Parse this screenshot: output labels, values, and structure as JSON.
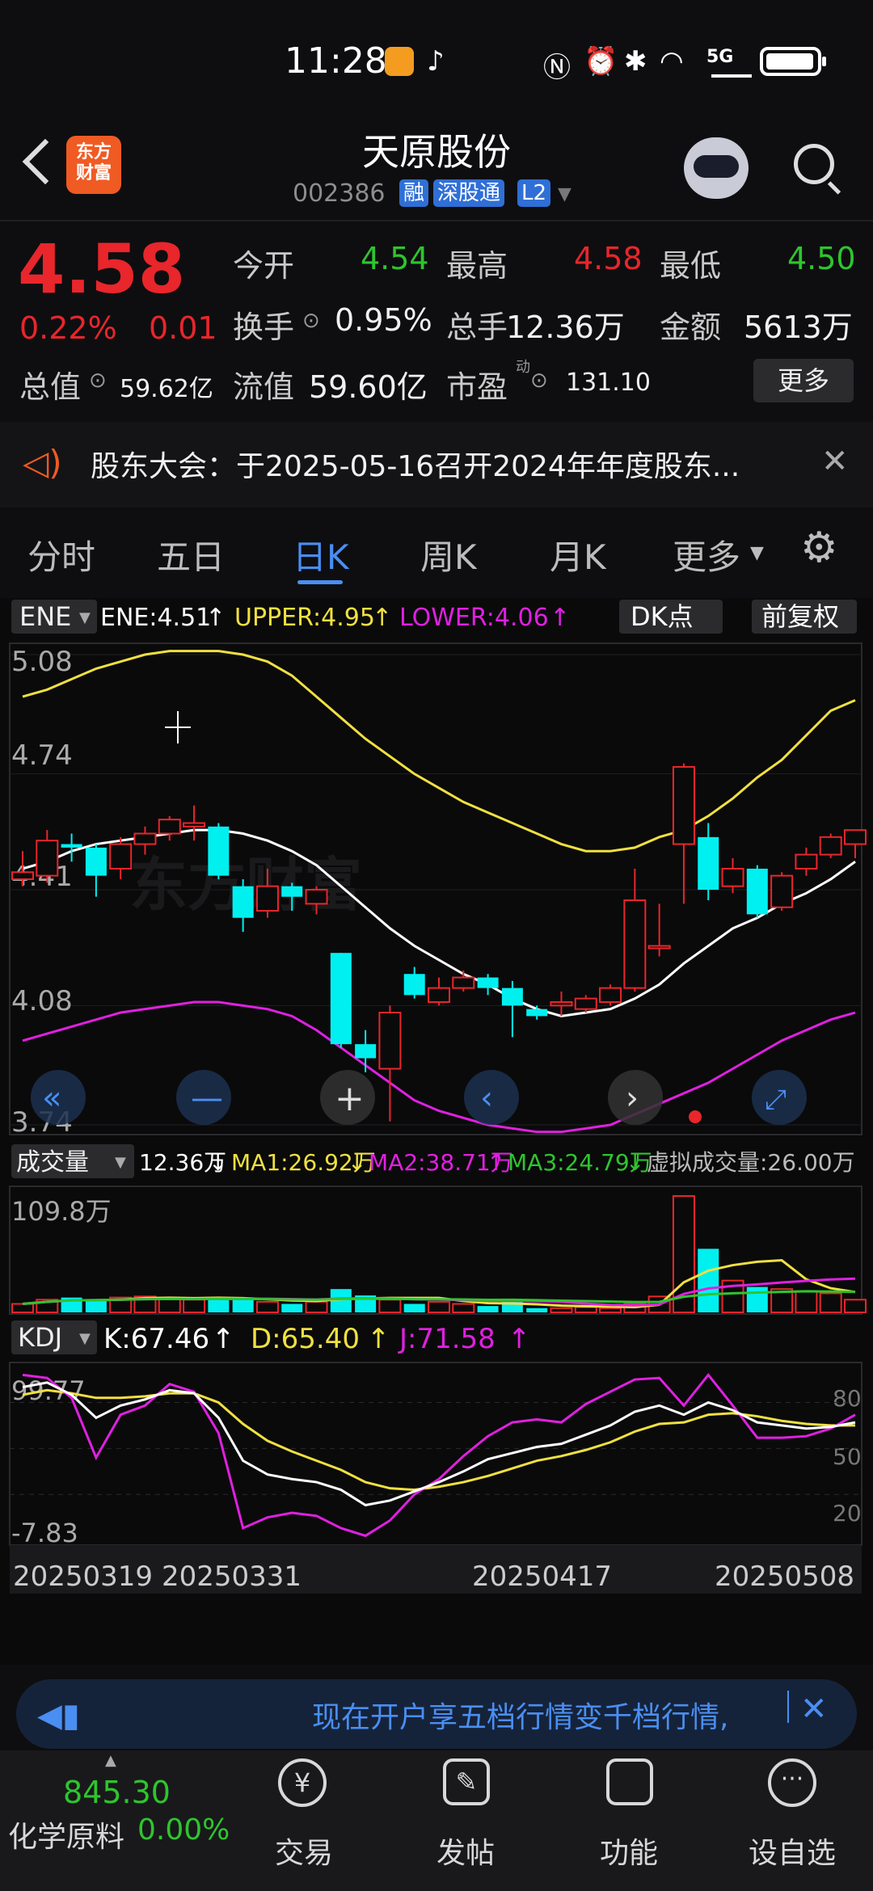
{
  "status_bar": {
    "time": "11:28",
    "network": "5G"
  },
  "header": {
    "logo_text": "东方\n财富",
    "title": "天原股份",
    "code": "002386",
    "tags": [
      "融",
      "深股通",
      "L2"
    ]
  },
  "quote": {
    "price": "4.58",
    "change_pct": "0.22%",
    "change": "0.01",
    "fields": [
      {
        "label": "今开",
        "value": "4.54"
      },
      {
        "label": "最高",
        "value": "4.58"
      },
      {
        "label": "最低",
        "value": "4.50"
      },
      {
        "label": "换手",
        "value": "0.95%"
      },
      {
        "label": "总手",
        "value": "12.36万"
      },
      {
        "label": "金额",
        "value": "5613万"
      },
      {
        "label": "总值",
        "value": "59.62亿"
      },
      {
        "label": "流值",
        "value": "59.60亿"
      },
      {
        "label": "市盈",
        "value": "131.10",
        "sup": "动"
      }
    ],
    "more_label": "更多"
  },
  "notice": {
    "text": "股东大会：于2025-05-16召开2024年年度股东..."
  },
  "tabs": [
    {
      "label": "分时",
      "active": false
    },
    {
      "label": "五日",
      "active": false
    },
    {
      "label": "日K",
      "active": true
    },
    {
      "label": "周K",
      "active": false
    },
    {
      "label": "月K",
      "active": false
    },
    {
      "label": "更多",
      "active": false
    }
  ],
  "colors": {
    "up": "#e8262b",
    "down": "#00f0f0",
    "ma_white": "#ffffff",
    "upper": "#f0e040",
    "lower": "#e020e0",
    "accent": "#4a8ef2"
  },
  "chart_data": [
    {
      "type": "candlestick",
      "indicator": {
        "name": "ENE",
        "ene": "ENE:4.51",
        "upper": "UPPER:4.95",
        "lower": "LOWER:4.06"
      },
      "buttons": [
        "DK点",
        "前复权"
      ],
      "y_ticks": [
        "5.08",
        "4.74",
        "4.41",
        "4.08",
        "3.74"
      ],
      "ylim": [
        3.74,
        5.08
      ],
      "candles": [
        {
          "o": 4.44,
          "c": 4.46,
          "h": 4.52,
          "l": 4.42
        },
        {
          "o": 4.45,
          "c": 4.55,
          "h": 4.58,
          "l": 4.43
        },
        {
          "o": 4.54,
          "c": 4.53,
          "h": 4.57,
          "l": 4.49
        },
        {
          "o": 4.53,
          "c": 4.45,
          "h": 4.54,
          "l": 4.39
        },
        {
          "o": 4.47,
          "c": 4.54,
          "h": 4.56,
          "l": 4.44
        },
        {
          "o": 4.54,
          "c": 4.57,
          "h": 4.59,
          "l": 4.51
        },
        {
          "o": 4.57,
          "c": 4.61,
          "h": 4.62,
          "l": 4.55
        },
        {
          "o": 4.59,
          "c": 4.6,
          "h": 4.65,
          "l": 4.55
        },
        {
          "o": 4.59,
          "c": 4.45,
          "h": 4.6,
          "l": 4.44
        },
        {
          "o": 4.42,
          "c": 4.33,
          "h": 4.44,
          "l": 4.29
        },
        {
          "o": 4.35,
          "c": 4.42,
          "h": 4.47,
          "l": 4.33
        },
        {
          "o": 4.42,
          "c": 4.39,
          "h": 4.43,
          "l": 4.35
        },
        {
          "o": 4.37,
          "c": 4.41,
          "h": 4.42,
          "l": 4.34
        },
        {
          "o": 4.23,
          "c": 3.97,
          "h": 4.23,
          "l": 3.96
        },
        {
          "o": 3.97,
          "c": 3.93,
          "h": 4.01,
          "l": 3.89
        },
        {
          "o": 3.9,
          "c": 4.06,
          "h": 4.08,
          "l": 3.75
        },
        {
          "o": 4.17,
          "c": 4.11,
          "h": 4.19,
          "l": 4.1
        },
        {
          "o": 4.09,
          "c": 4.13,
          "h": 4.16,
          "l": 4.08
        },
        {
          "o": 4.13,
          "c": 4.16,
          "h": 4.18,
          "l": 4.12
        },
        {
          "o": 4.16,
          "c": 4.13,
          "h": 4.17,
          "l": 4.11
        },
        {
          "o": 4.13,
          "c": 4.08,
          "h": 4.15,
          "l": 3.99
        },
        {
          "o": 4.07,
          "c": 4.05,
          "h": 4.08,
          "l": 4.04
        },
        {
          "o": 4.08,
          "c": 4.09,
          "h": 4.12,
          "l": 4.05
        },
        {
          "o": 4.07,
          "c": 4.1,
          "h": 4.11,
          "l": 4.06
        },
        {
          "o": 4.09,
          "c": 4.13,
          "h": 4.14,
          "l": 4.08
        },
        {
          "o": 4.13,
          "c": 4.38,
          "h": 4.47,
          "l": 4.12
        },
        {
          "o": 4.25,
          "c": 4.25,
          "h": 4.37,
          "l": 4.22
        },
        {
          "o": 4.54,
          "c": 4.76,
          "h": 4.77,
          "l": 4.37
        },
        {
          "o": 4.56,
          "c": 4.41,
          "h": 4.6,
          "l": 4.38
        },
        {
          "o": 4.42,
          "c": 4.47,
          "h": 4.5,
          "l": 4.4
        },
        {
          "o": 4.47,
          "c": 4.34,
          "h": 4.48,
          "l": 4.33
        },
        {
          "o": 4.36,
          "c": 4.45,
          "h": 4.46,
          "l": 4.35
        },
        {
          "o": 4.47,
          "c": 4.51,
          "h": 4.53,
          "l": 4.45
        },
        {
          "o": 4.51,
          "c": 4.56,
          "h": 4.57,
          "l": 4.5
        },
        {
          "o": 4.54,
          "c": 4.58,
          "h": 4.58,
          "l": 4.5
        }
      ],
      "ene": [
        4.47,
        4.49,
        4.52,
        4.54,
        4.55,
        4.56,
        4.57,
        4.58,
        4.58,
        4.57,
        4.55,
        4.52,
        4.48,
        4.42,
        4.36,
        4.3,
        4.25,
        4.21,
        4.17,
        4.14,
        4.1,
        4.07,
        4.05,
        4.06,
        4.07,
        4.1,
        4.14,
        4.2,
        4.25,
        4.3,
        4.33,
        4.37,
        4.4,
        4.44,
        4.49
      ],
      "upper": [
        4.96,
        4.98,
        5.01,
        5.04,
        5.06,
        5.08,
        5.09,
        5.09,
        5.09,
        5.08,
        5.06,
        5.02,
        4.96,
        4.9,
        4.84,
        4.79,
        4.74,
        4.7,
        4.66,
        4.63,
        4.6,
        4.57,
        4.54,
        4.52,
        4.52,
        4.53,
        4.56,
        4.58,
        4.62,
        4.67,
        4.73,
        4.78,
        4.85,
        4.92,
        4.95
      ],
      "lower": [
        3.98,
        4.0,
        4.02,
        4.04,
        4.06,
        4.07,
        4.08,
        4.09,
        4.09,
        4.08,
        4.07,
        4.05,
        4.01,
        3.96,
        3.91,
        3.86,
        3.81,
        3.78,
        3.76,
        3.74,
        3.73,
        3.72,
        3.72,
        3.73,
        3.74,
        3.77,
        3.8,
        3.83,
        3.86,
        3.9,
        3.94,
        3.98,
        4.01,
        4.04,
        4.06
      ]
    },
    {
      "type": "bar",
      "indicator": {
        "name": "成交量",
        "vol": "12.36万",
        "ma1": "MA1:26.92万",
        "ma2": "MA2:38.71万",
        "ma3": "MA3:24.79万",
        "virtual": "虚拟成交量:26.00万"
      },
      "y_ticks": [
        "109.8万"
      ],
      "ylim": [
        0,
        109.8
      ],
      "values": [
        8,
        12,
        14,
        12,
        14,
        15,
        14,
        12,
        14,
        12,
        10,
        8,
        10,
        22,
        16,
        12,
        8,
        10,
        8,
        6,
        10,
        4,
        4,
        5,
        4,
        8,
        15,
        109.8,
        60,
        30,
        24,
        22,
        20,
        18,
        12
      ]
    },
    {
      "type": "line",
      "indicator": {
        "name": "KDJ",
        "k": "K:67.46",
        "d": "D:65.40",
        "j": "J:71.58"
      },
      "y_ticks": [
        "99.77",
        "-7.83"
      ],
      "right_ticks": [
        "80",
        "50",
        "20"
      ],
      "ylim": [
        -7.83,
        99.77
      ],
      "K": [
        90,
        93,
        85,
        70,
        78,
        82,
        88,
        86,
        70,
        42,
        33,
        30,
        28,
        23,
        13,
        16,
        22,
        28,
        35,
        43,
        47,
        51,
        53,
        59,
        65,
        74,
        78,
        72,
        80,
        75,
        67,
        65,
        63,
        64,
        67
      ],
      "D": [
        85,
        88,
        86,
        83,
        83,
        84,
        86,
        86,
        80,
        66,
        55,
        48,
        42,
        36,
        28,
        24,
        23,
        25,
        28,
        32,
        37,
        42,
        45,
        49,
        54,
        61,
        66,
        67,
        72,
        73,
        71,
        68,
        66,
        65,
        65
      ],
      "J": [
        98,
        96,
        83,
        44,
        72,
        78,
        92,
        87,
        60,
        -2,
        5,
        8,
        6,
        -2,
        -7,
        3,
        20,
        30,
        45,
        58,
        67,
        69,
        67,
        79,
        87,
        95,
        96,
        78,
        98,
        78,
        57,
        57,
        58,
        63,
        72
      ],
      "x_ticks": [
        "20250319",
        "20250331",
        "20250417",
        "20250508"
      ]
    }
  ],
  "ad": {
    "text": "现在开户享五档行情变千档行情,"
  },
  "bottom_nav": {
    "index_value": "845.30",
    "index_name": "化学原料",
    "index_change": "0.00%",
    "items": [
      "交易",
      "发帖",
      "功能",
      "设自选"
    ]
  }
}
